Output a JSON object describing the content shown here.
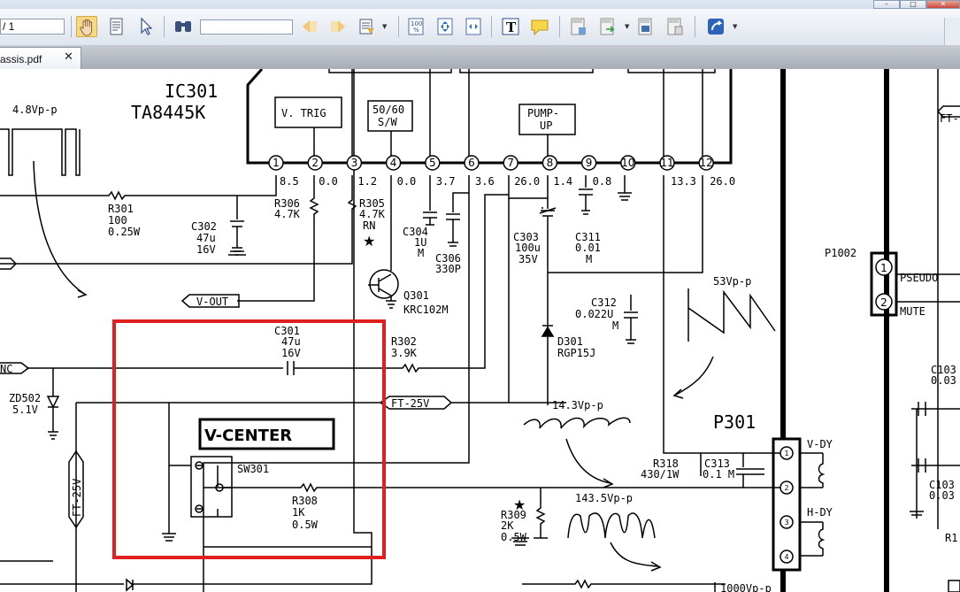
{
  "window": {
    "minimize": "–",
    "maximize": "□",
    "close": "✕"
  },
  "toolbar": {
    "page_value": "/ 1",
    "search_placeholder": "",
    "icons": [
      "hand-tool-icon",
      "text-select-icon",
      "pointer-icon",
      "find-icon",
      "prev-page-icon",
      "next-page-icon",
      "zoom-menu-icon",
      "actual-size-icon",
      "fit-page-icon",
      "fit-width-icon",
      "typewriter-icon",
      "comment-icon",
      "pdf-create-icon",
      "pdf-export-icon",
      "pdf-merge-icon",
      "pdf-convert-icon",
      "share-icon"
    ]
  },
  "tab": {
    "label": "assis.pdf",
    "close": "✕"
  },
  "schematic": {
    "ic_name": "IC301",
    "ic_part": "TA8445K",
    "waveform_top_left": "4.8Vp-p",
    "blocks": {
      "vtrig": "V. TRIG",
      "fiftysixty_1": "50/60",
      "fiftysixty_2": "S/W",
      "pump_1": "PUMP-",
      "pump_2": "UP"
    },
    "pins": [
      "1",
      "2",
      "3",
      "4",
      "5",
      "6",
      "7",
      "8",
      "9",
      "10",
      "11",
      "12"
    ],
    "pin_voltages": [
      "8.5",
      "0.0",
      "1.2",
      "0.0",
      "3.7",
      "3.6",
      "26.0",
      "1.4",
      "0.8",
      "",
      "13.3",
      "26.0"
    ],
    "components": {
      "r301": [
        "R301",
        "100",
        "0.25W"
      ],
      "c302": [
        "C302",
        "47u",
        "16V"
      ],
      "r306": [
        "R306",
        "4.7K"
      ],
      "r305": [
        "R305",
        "4.7K",
        "RN"
      ],
      "c304": [
        "C304",
        "1U",
        "M"
      ],
      "c306": [
        "C306",
        "330P"
      ],
      "c303": [
        "C303",
        "100u",
        "35V"
      ],
      "c311": [
        "C311",
        "0.01",
        "M"
      ],
      "q301": [
        "Q301",
        "KRC102M"
      ],
      "c312": [
        "C312",
        "0.022U",
        "M"
      ],
      "d301": [
        "D301",
        "RGP15J"
      ],
      "c301": [
        "C301",
        "47u",
        "16V"
      ],
      "r302": [
        "R302",
        "3.9K"
      ],
      "zd502": [
        "ZD502",
        "5.1V"
      ],
      "sw301": "SW301",
      "r308": [
        "R308",
        "1K",
        "0.5W"
      ],
      "r309": [
        "R309",
        "2K",
        "0.5W"
      ],
      "r318": [
        "R318",
        "430/1W"
      ],
      "c313": [
        "C313",
        "0.1 M"
      ],
      "p1002": "P1002",
      "p301": "P301"
    },
    "labels": {
      "v_out": "V-OUT",
      "nc": "NC",
      "ft25v_h": "FT-25V",
      "ft25v_v": "FT-25V",
      "ft_right": "FT-",
      "v_center": "V-CENTER",
      "pseudo": "PSEUDO",
      "mute": "MUTE",
      "vdy": "V-DY",
      "hdy": "H-DY",
      "w53": "53Vp-p",
      "w143": "14.3Vp-p",
      "w1435": "143.5Vp-p",
      "w1000": "1000Vp-p",
      "c103a": "C103",
      "c103a2": "0.03",
      "c103b": "C103",
      "c103b2": "0.03",
      "r1": "R1"
    },
    "connector_pins": [
      "1",
      "2"
    ],
    "p301_pins": [
      "1",
      "2",
      "3",
      "4"
    ],
    "highlight_color": "#e02020"
  }
}
